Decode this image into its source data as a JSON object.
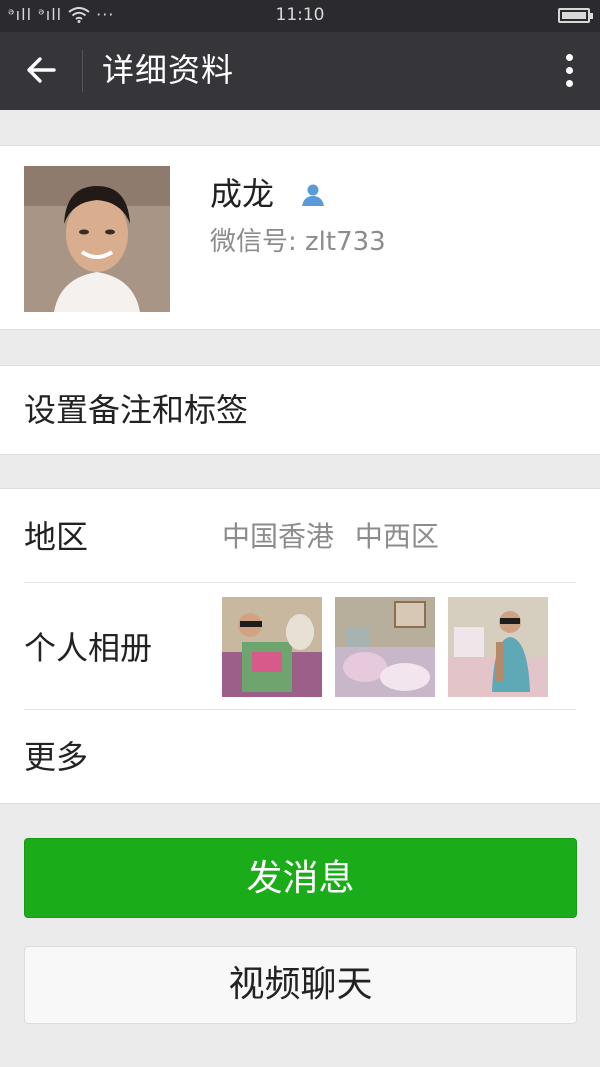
{
  "status_bar": {
    "signal_text": "ᵊıll ᵊıll",
    "wifi_icon": "wifi-icon",
    "dots": "···",
    "time": "11:10",
    "battery_icon": "battery-icon",
    "battery_level": 1.0
  },
  "header": {
    "title": "详细资料",
    "back_icon": "arrow-left-icon",
    "more_icon": "more-vertical-icon"
  },
  "profile": {
    "name": "成龙",
    "contact_icon": "contact-person-icon",
    "wechat_id": "微信号: zlt733"
  },
  "remark_row": {
    "label": "设置备注和标签"
  },
  "details": {
    "region_label": "地区",
    "region_value": "中国香港  中西区",
    "album_label": "个人相册",
    "more_label": "更多"
  },
  "buttons": {
    "send_message": "发消息",
    "video_chat": "视频聊天"
  },
  "colors": {
    "header_bg": "#35353a",
    "status_bg": "#2b2b2f",
    "primary_button": "#1aad19",
    "contact_icon": "#5a9ad8"
  }
}
